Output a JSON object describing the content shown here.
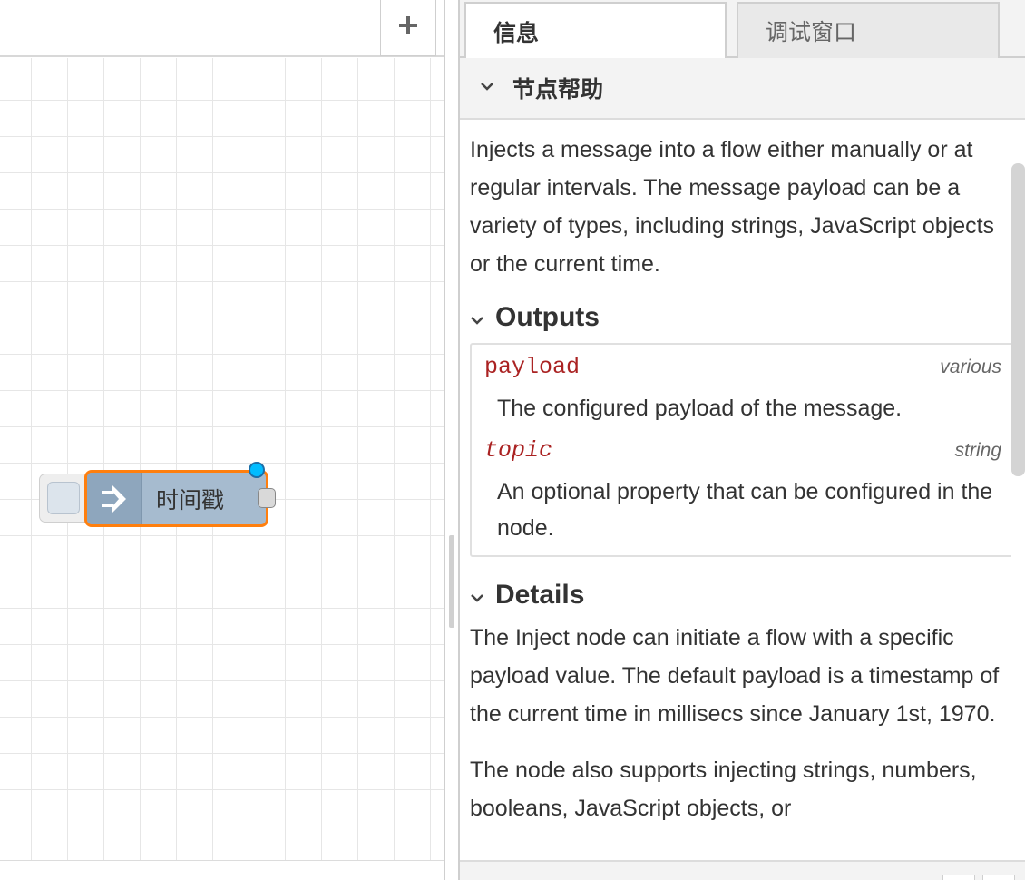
{
  "workspace": {
    "add_button_icon": "plus-icon",
    "node": {
      "label": "时间戳",
      "icon": "inject-arrow-icon",
      "body_color": "#a6bbcf",
      "selected_border_color": "#ff7f0e",
      "changed_indicator_color": "#00bcff"
    }
  },
  "sidebar": {
    "tabs": [
      {
        "label": "信息",
        "active": true
      },
      {
        "label": "调试窗口",
        "active": false
      }
    ],
    "section_title": "节点帮助",
    "intro": "Injects a message into a flow either manually or at regular intervals. The message payload can be a variety of types, including strings, JavaScript objects or the current time.",
    "outputs": {
      "header": "Outputs",
      "properties": [
        {
          "name": "payload",
          "type": "various",
          "description": "The configured payload of the message."
        },
        {
          "name": "topic",
          "type": "string",
          "description": "An optional property that can be configured in the node."
        }
      ]
    },
    "details": {
      "header": "Details",
      "paragraphs": [
        "The Inject node can initiate a flow with a specific payload value. The default payload is a timestamp of the current time in millisecs since January 1st, 1970.",
        "The node also supports injecting strings, numbers, booleans, JavaScript objects, or"
      ]
    }
  }
}
